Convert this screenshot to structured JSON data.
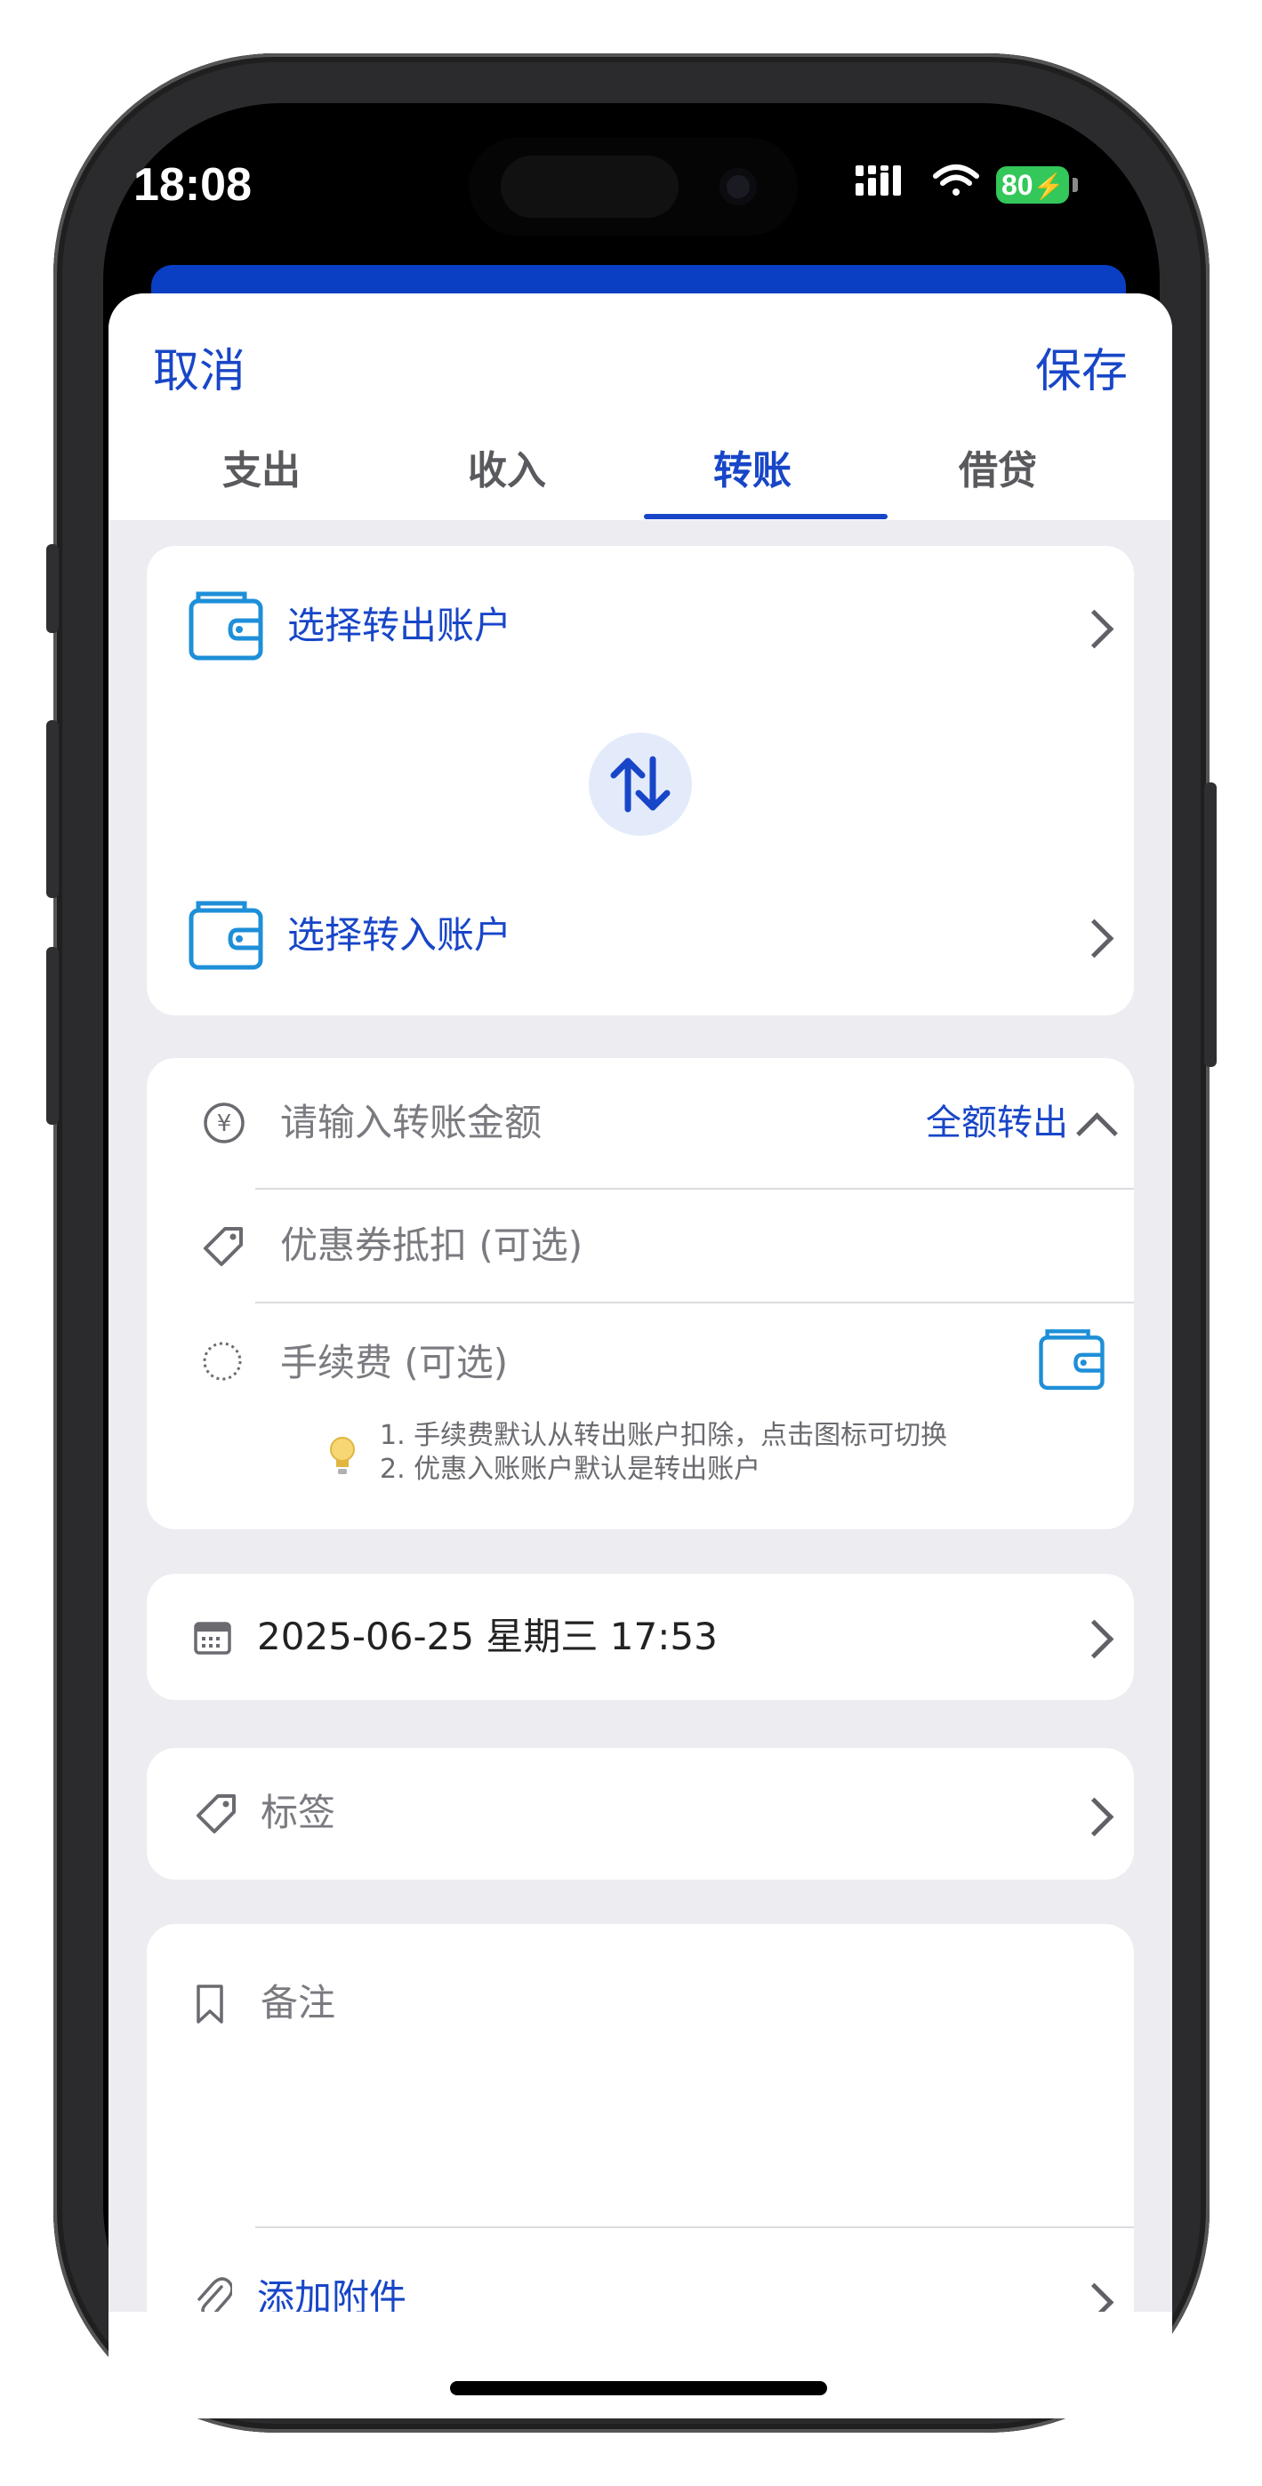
{
  "status_bar": {
    "time": "18:08",
    "battery": "80",
    "icons": [
      "signal-icon",
      "wifi-icon",
      "battery-charging-icon"
    ]
  },
  "header": {
    "cancel_label": "取消",
    "save_label": "保存"
  },
  "tabs": [
    {
      "label": "支出",
      "active": false
    },
    {
      "label": "收入",
      "active": false
    },
    {
      "label": "转账",
      "active": true
    },
    {
      "label": "借贷",
      "active": false
    }
  ],
  "accounts": {
    "from_label": "选择转出账户",
    "to_label": "选择转入账户",
    "icons": [
      "wallet-icon",
      "swap-arrows-icon"
    ]
  },
  "amount": {
    "placeholder": "请输入转账金额",
    "full_transfer_label": "全额转出",
    "coupon_placeholder": "优惠券抵扣 (可选)",
    "fee_placeholder": "手续费 (可选)",
    "tips": [
      "1. 手续费默认从转出账户扣除，点击图标可切换",
      "2. 优惠入账账户默认是转出账户"
    ]
  },
  "datetime": {
    "value": "2025-06-25 星期三 17:53"
  },
  "tags": {
    "label": "标签"
  },
  "notes": {
    "placeholder": "备注",
    "attachment_label": "添加附件"
  },
  "colors": {
    "accent": "#1846c8",
    "wallet_icon": "#1e8fd8",
    "background": "#ececf1"
  }
}
